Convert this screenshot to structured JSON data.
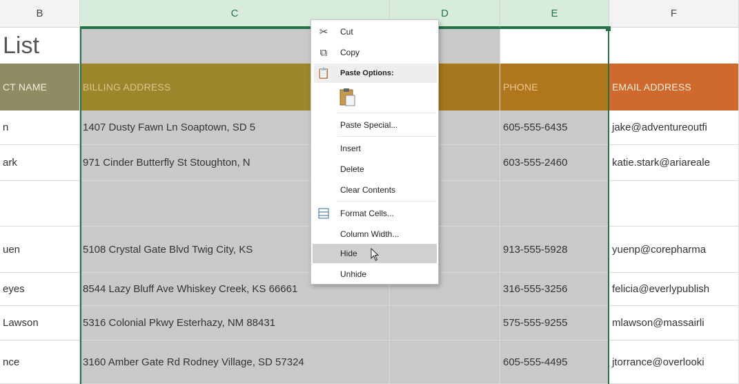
{
  "columns": [
    "B",
    "C",
    "D",
    "E",
    "F"
  ],
  "title_partial": "List",
  "headers": {
    "b": "CT NAME",
    "c": "BILLING ADDRESS",
    "e": "PHONE",
    "f": "EMAIL ADDRESS"
  },
  "rows": [
    {
      "b": "n",
      "c": "1407 Dusty Fawn Ln Soaptown, SD 5",
      "e": "605-555-6435",
      "f": "jake@adventureoutfi"
    },
    {
      "b": "ark",
      "c": "971 Cinder Butterfly St Stoughton, N",
      "e": "603-555-2460",
      "f": "katie.stark@ariareale"
    },
    {
      "b": "",
      "c": "",
      "e": "",
      "f": ""
    },
    {
      "b": "uen",
      "c": "5108 Crystal Gate Blvd Twig City, KS",
      "e": "913-555-5928",
      "f": "yuenp@corepharma"
    },
    {
      "b": "eyes",
      "c": "8544 Lazy Bluff Ave Whiskey Creek, KS 66661",
      "e": "316-555-3256",
      "f": "felicia@everlypublish"
    },
    {
      "b": "Lawson",
      "c": "5316 Colonial Pkwy Esterhazy, NM 88431",
      "e": "575-555-9255",
      "f": "mlawson@massairli"
    },
    {
      "b": "nce",
      "c": "3160 Amber Gate Rd Rodney Village, SD 57324",
      "e": "605-555-4495",
      "f": "jtorrance@overlooki"
    }
  ],
  "menu": {
    "cut": "Cut",
    "copy": "Copy",
    "paste_options": "Paste Options:",
    "paste_special": "Paste Special...",
    "insert": "Insert",
    "delete": "Delete",
    "clear_contents": "Clear Contents",
    "format_cells": "Format Cells...",
    "column_width": "Column Width...",
    "hide": "Hide",
    "unhide": "Unhide"
  },
  "colors": {
    "header_b": "#8f8b62",
    "header_c": "#9c862c",
    "header_d": "#a8781e",
    "header_e": "#b0761b",
    "header_f": "#cf6a2c",
    "selection": "#217346"
  }
}
